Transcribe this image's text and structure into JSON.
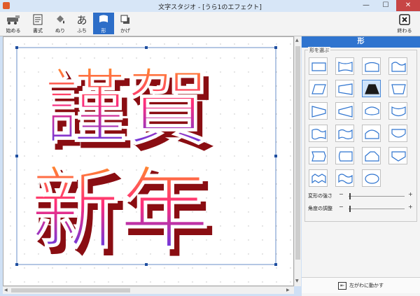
{
  "window": {
    "title": "文字スタジオ - [うら1のエフェクト]",
    "minimize": "—",
    "maximize": "☐",
    "close": "✕"
  },
  "toolbar": {
    "items": [
      {
        "label": "始める",
        "icon": "start-icon"
      },
      {
        "label": "書式",
        "icon": "format-icon"
      },
      {
        "label": "ぬり",
        "icon": "paint-bucket-icon"
      },
      {
        "label": "ふち",
        "icon": "outline-a-icon"
      },
      {
        "label": "形",
        "icon": "flag-shape-icon"
      },
      {
        "label": "かげ",
        "icon": "shadow-icon"
      }
    ],
    "exit_label": "終わる",
    "active": "形"
  },
  "canvas": {
    "line1": "謹賀",
    "line2": "新年",
    "colors": {
      "top": "#ff9a1e",
      "mid": "#ff2d7a",
      "bottom": "#3c3cff",
      "extrude": "#8a0d12"
    }
  },
  "panel": {
    "title": "形",
    "shape_group_label": "形を選ぶ",
    "shapes": [
      "rectangle",
      "bow-tie",
      "arch-top",
      "wave-top",
      "parallelogram",
      "trapezoid-right",
      "trapezoid-up",
      "chevron-down",
      "triangle-right",
      "triangle-left",
      "bulge-top",
      "bulge-bottom",
      "wave-left",
      "wave-right",
      "dome",
      "bowl",
      "notch-right",
      "notch-left",
      "pentagon",
      "shield",
      "zigzag",
      "double-wave",
      "ellipse"
    ],
    "selected_shape_index": 6,
    "sliders": [
      {
        "label": "変形の強さ",
        "value": 0.0
      },
      {
        "label": "角度の調整",
        "value": 0.0
      }
    ],
    "move_button_label": "左がわに動かす"
  },
  "accent": "#2f74cf"
}
